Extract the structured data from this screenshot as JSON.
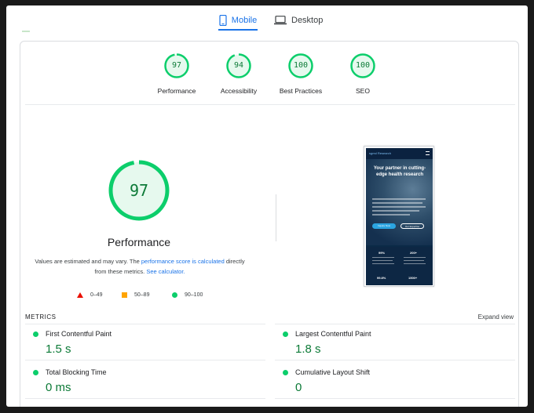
{
  "tabs": {
    "mobile_label": "Mobile",
    "desktop_label": "Desktop"
  },
  "gauges": [
    {
      "score": "97",
      "label": "Performance"
    },
    {
      "score": "94",
      "label": "Accessibility"
    },
    {
      "score": "100",
      "label": "Best Practices"
    },
    {
      "score": "100",
      "label": "SEO"
    }
  ],
  "performance": {
    "score": "97",
    "title": "Performance",
    "note_prefix": "Values are estimated and may vary. The ",
    "note_link1": "performance score is calculated",
    "note_middle": " directly from these metrics. ",
    "note_link2": "See calculator."
  },
  "legend": {
    "poor": "0–49",
    "average": "50–89",
    "good": "90–100"
  },
  "thumbnail": {
    "logo": "sgmd Research",
    "headline": "Your partner in cutting-edge health research",
    "button1": "Inquire Now",
    "button2": "Our Expertise",
    "stat1": "99%",
    "stat2": "200+",
    "stat3": "99.8%",
    "stat4": "1500+"
  },
  "metrics": {
    "title": "METRICS",
    "expand_label": "Expand view",
    "items": [
      {
        "name": "First Contentful Paint",
        "value": "1.5 s"
      },
      {
        "name": "Largest Contentful Paint",
        "value": "1.8 s"
      },
      {
        "name": "Total Blocking Time",
        "value": "0 ms"
      },
      {
        "name": "Cumulative Layout Shift",
        "value": "0"
      }
    ]
  },
  "colors": {
    "good": "#0cce6b",
    "good_text": "#0c7a37",
    "accent": "#1a73e8",
    "poor": "#eb0f00",
    "average": "#ffa400"
  }
}
